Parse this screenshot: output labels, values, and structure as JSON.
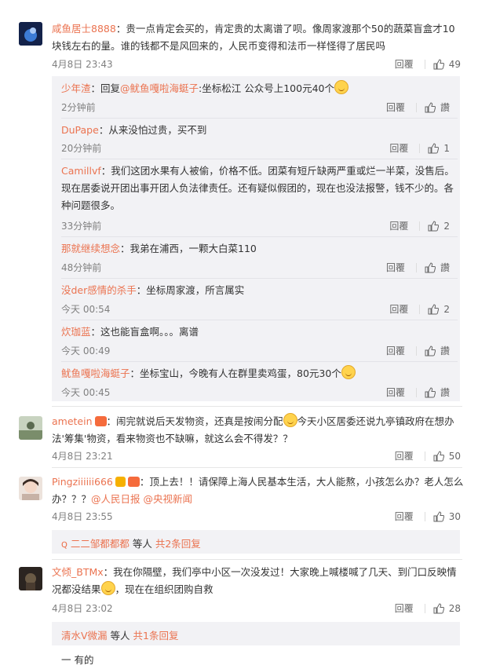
{
  "labels": {
    "reply": "回覆"
  },
  "comments": [
    {
      "user": "咸鱼居士8888",
      "text": "：贵一点肯定会买的，肯定贵的太离谱了呗。像周家渡那个50的蔬菜盲盒才10块钱左右的量。谁的钱都不是风回来的，人民币变得和法币一样怪得了居民吗",
      "time": "4月8日 23:43",
      "likes": "49",
      "replies": [
        {
          "user": "少年渣",
          "prefix": "：回复",
          "mention": "@鱿鱼嘎啦海蜓子",
          "text": ":坐标松江 公众号上100元40个",
          "time": "2分钟前",
          "likes": "讚"
        },
        {
          "user": "DuPape",
          "text": "：从来没怕过贵，买不到",
          "time": "20分钟前",
          "likes": "1"
        },
        {
          "user": "Camillvf",
          "text": "：我们这团水果有人被偷，价格不低。团菜有短斤缺两严重或烂一半菜，没售后。现在居委说开团出事开团人负法律责任。还有疑似假团的，现在也没法报警，钱不少的。各种问题很多。",
          "time": "33分钟前",
          "likes": "2"
        },
        {
          "user": "那就继续想念",
          "text": "：我弟在浦西，一颗大白菜110",
          "time": "48分钟前",
          "likes": "讚"
        },
        {
          "user": "没der感情的杀手",
          "text": "：坐标周家渡，所言属实",
          "time": "今天 00:54",
          "likes": "2"
        },
        {
          "user": "炊珈蓝",
          "text": "：这也能盲盒啊。。。离谱",
          "time": "今天 00:49",
          "likes": "讚"
        },
        {
          "user": "鱿鱼嘎啦海蜓子",
          "text": "：坐标宝山，今晚有人在群里卖鸡蛋，80元30个",
          "time": "今天 00:45",
          "likes": "讚"
        }
      ]
    },
    {
      "user": "ametein",
      "text": "：闹完就说后天发物资，还真是按闹分配",
      "text2": "今天小区居委还说九亭镇政府在想办法'筹集'物资，看来物资也不缺嘛，就这么会不得发？？",
      "time": "4月8日 23:21",
      "likes": "50"
    },
    {
      "user": "Pingziiiiii666",
      "text": "：顶上去！！请保障上海人民基本生活，大人能熬，小孩怎么办？老人怎么办？？？",
      "mentions": "@人民日报 @央视新闻",
      "time": "4月8日 23:55",
      "likes": "30",
      "more": {
        "users": "二二邹都都都",
        "suffix": " 等人 ",
        "count": "共2条回复"
      }
    },
    {
      "user": "文倾_BTMx",
      "text": "：我在你隔壁，我们亭中小区一次没发过！大家晚上喊楼喊了几天、到门口反映情况都没结果",
      "text2": "，现在在组织团购自救",
      "time": "4月8日 23:02",
      "likes": "28",
      "more": {
        "users": "清水V微漏",
        "suffix": " 等人 ",
        "count": "共1条回复"
      }
    }
  ],
  "partial_bottom": "一 有的",
  "colors": {
    "name": "#eb7350",
    "reply_bg": "#f2f2f5",
    "time": "#808080"
  }
}
